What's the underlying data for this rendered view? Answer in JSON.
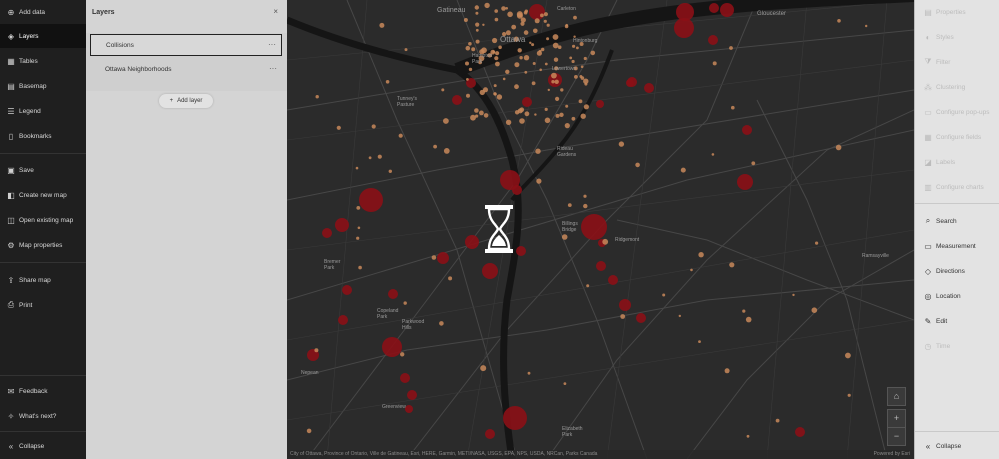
{
  "left_nav": {
    "items": [
      {
        "icon": "add-data-icon",
        "glyph": "⊕",
        "label": "Add data"
      },
      {
        "icon": "layers-icon",
        "glyph": "◈",
        "label": "Layers",
        "active": true
      },
      {
        "icon": "tables-icon",
        "glyph": "▦",
        "label": "Tables"
      },
      {
        "icon": "basemap-icon",
        "glyph": "▤",
        "label": "Basemap"
      },
      {
        "icon": "legend-icon",
        "glyph": "☰",
        "label": "Legend"
      },
      {
        "icon": "bookmarks-icon",
        "glyph": "▯",
        "label": "Bookmarks"
      },
      {
        "icon": "save-icon",
        "glyph": "▣",
        "label": "Save"
      },
      {
        "icon": "create-new-map-icon",
        "glyph": "◧",
        "label": "Create new map"
      },
      {
        "icon": "open-existing-map-icon",
        "glyph": "◫",
        "label": "Open existing map"
      },
      {
        "icon": "map-properties-icon",
        "glyph": "⚙",
        "label": "Map properties"
      },
      {
        "icon": "share-map-icon",
        "glyph": "⇪",
        "label": "Share map"
      },
      {
        "icon": "print-icon",
        "glyph": "⎙",
        "label": "Print"
      },
      {
        "icon": "feedback-icon",
        "glyph": "✉",
        "label": "Feedback"
      },
      {
        "icon": "whats-next-icon",
        "glyph": "✧",
        "label": "What's next?"
      },
      {
        "icon": "collapse-icon",
        "glyph": "«",
        "label": "Collapse"
      }
    ]
  },
  "layers_panel": {
    "title": "Layers",
    "close_glyph": "×",
    "layers": [
      {
        "name": "Collisions",
        "selected": true
      },
      {
        "name": "Ottawa Neighborhoods",
        "selected": false
      }
    ],
    "more_glyph": "···",
    "add_layer_label": "Add layer",
    "add_layer_glyph": "+"
  },
  "map": {
    "place_labels": [
      {
        "text": "Gatineau"
      },
      {
        "text": "Ottawa"
      },
      {
        "text": "Gloucester"
      },
      {
        "text": "Hintonburg"
      },
      {
        "text": "Tunney's Pasture"
      },
      {
        "text": "Rideau Gardens"
      },
      {
        "text": "Billings Bridge"
      },
      {
        "text": "Ridgemont"
      },
      {
        "text": "Ramsayville"
      },
      {
        "text": "Bremer Park"
      },
      {
        "text": "Copeland Park"
      },
      {
        "text": "Parkwood Hills"
      },
      {
        "text": "Nepean"
      },
      {
        "text": "Greenview"
      },
      {
        "text": "Elizabeth Park"
      },
      {
        "text": "Hampton Park"
      },
      {
        "text": "Lowertown"
      },
      {
        "text": "Carleton"
      }
    ],
    "attribution": "City of Ottawa, Province of Ontario, Ville de Gatineau, Esri, HERE, Garmin, METI/NASA, USGS, EPA, NPS, USDA, NRCan, Parks Canada",
    "powered_by": "Powered by Esri",
    "home_glyph": "⌂",
    "zoom_in_glyph": "+",
    "zoom_out_glyph": "−",
    "loading_icon": "hourglass-icon"
  },
  "right_tools": {
    "items": [
      {
        "icon": "properties-icon",
        "glyph": "▤",
        "label": "Properties",
        "disabled": true
      },
      {
        "icon": "styles-icon",
        "glyph": "◐",
        "label": "Styles",
        "disabled": true
      },
      {
        "icon": "filter-icon",
        "glyph": "⧩",
        "label": "Filter",
        "disabled": true
      },
      {
        "icon": "clustering-icon",
        "glyph": "⁂",
        "label": "Clustering",
        "disabled": true
      },
      {
        "icon": "configure-popups-icon",
        "glyph": "▭",
        "label": "Configure pop-ups",
        "disabled": true
      },
      {
        "icon": "configure-fields-icon",
        "glyph": "▦",
        "label": "Configure fields",
        "disabled": true
      },
      {
        "icon": "labels-icon",
        "glyph": "◪",
        "label": "Labels",
        "disabled": true
      },
      {
        "icon": "configure-charts-icon",
        "glyph": "▥",
        "label": "Configure charts",
        "disabled": true
      },
      {
        "icon": "search-icon",
        "glyph": "⌕",
        "label": "Search",
        "disabled": false
      },
      {
        "icon": "measurement-icon",
        "glyph": "▭",
        "label": "Measurement",
        "disabled": false
      },
      {
        "icon": "directions-icon",
        "glyph": "◇",
        "label": "Directions",
        "disabled": false
      },
      {
        "icon": "location-icon",
        "glyph": "◎",
        "label": "Location",
        "disabled": false
      },
      {
        "icon": "edit-icon",
        "glyph": "✎",
        "label": "Edit",
        "disabled": false
      },
      {
        "icon": "time-icon",
        "glyph": "◷",
        "label": "Time",
        "disabled": true
      },
      {
        "icon": "collapse-icon",
        "glyph": "«",
        "label": "Collapse",
        "disabled": false
      }
    ]
  },
  "colors": {
    "small_collision": "#c8885a",
    "large_collision": "#8b0f16",
    "map_bg": "#2b2b2b",
    "road": "#4a4a4a",
    "river": "#1a1a1a"
  }
}
